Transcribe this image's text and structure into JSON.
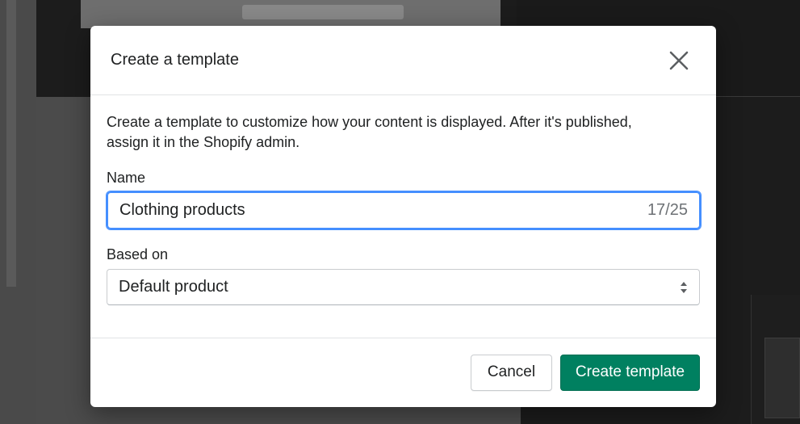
{
  "modal": {
    "title": "Create a template",
    "description": "Create a template to customize how your content is displayed. After it's published, assign it in the Shopify admin.",
    "name_field": {
      "label": "Name",
      "value": "Clothing products",
      "counter": "17/25"
    },
    "based_on_field": {
      "label": "Based on",
      "selected": "Default product"
    },
    "buttons": {
      "cancel": "Cancel",
      "create": "Create template"
    }
  },
  "icons": {
    "close": "close-icon",
    "select_arrows": "select-arrows-icon"
  },
  "colors": {
    "primary": "#008060",
    "focus": "#458fff"
  }
}
